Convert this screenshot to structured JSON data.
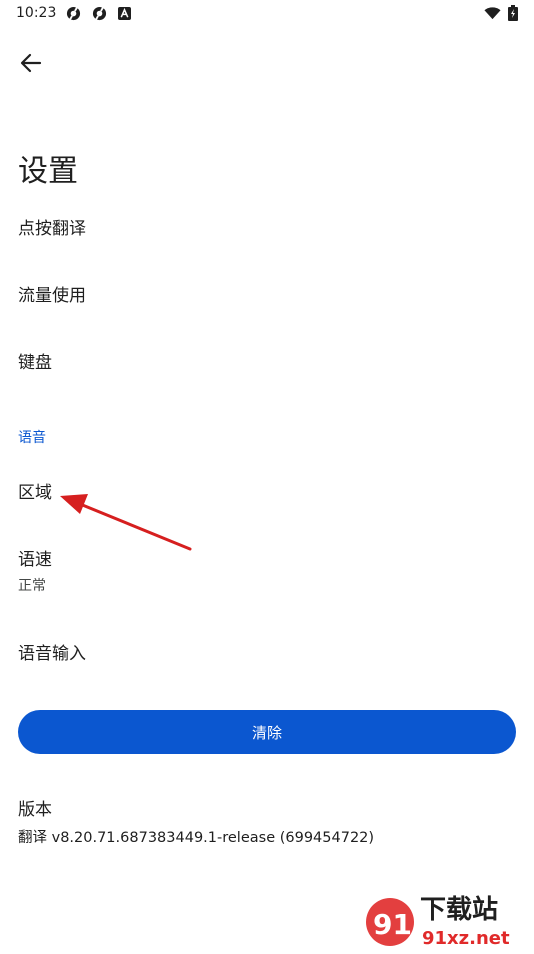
{
  "status_bar": {
    "time": "10:23",
    "icons": [
      "gear-notification-icon",
      "gear-notification-icon",
      "a-notification-icon",
      "wifi-icon",
      "battery-icon"
    ]
  },
  "header": {
    "back_icon": "arrow-left-icon"
  },
  "page": {
    "title": "设置"
  },
  "settings": {
    "tap_to_translate": "点按翻译",
    "data_usage": "流量使用",
    "keyboard": "键盘",
    "speech_section": "语音",
    "region": "区域",
    "speech_rate": {
      "label": "语速",
      "value": "正常"
    },
    "voice_input": "语音输入"
  },
  "clear_button": {
    "label": "清除"
  },
  "version": {
    "label": "版本",
    "value": "翻译 v8.20.71.687383449.1-release (699454722)"
  },
  "watermark": {
    "logo_text": "91",
    "title": "下载站",
    "url": "91xz.net"
  },
  "colors": {
    "accent": "#0b57d0",
    "annotation_arrow": "#d61f1f",
    "watermark_red": "#e02a2a"
  }
}
